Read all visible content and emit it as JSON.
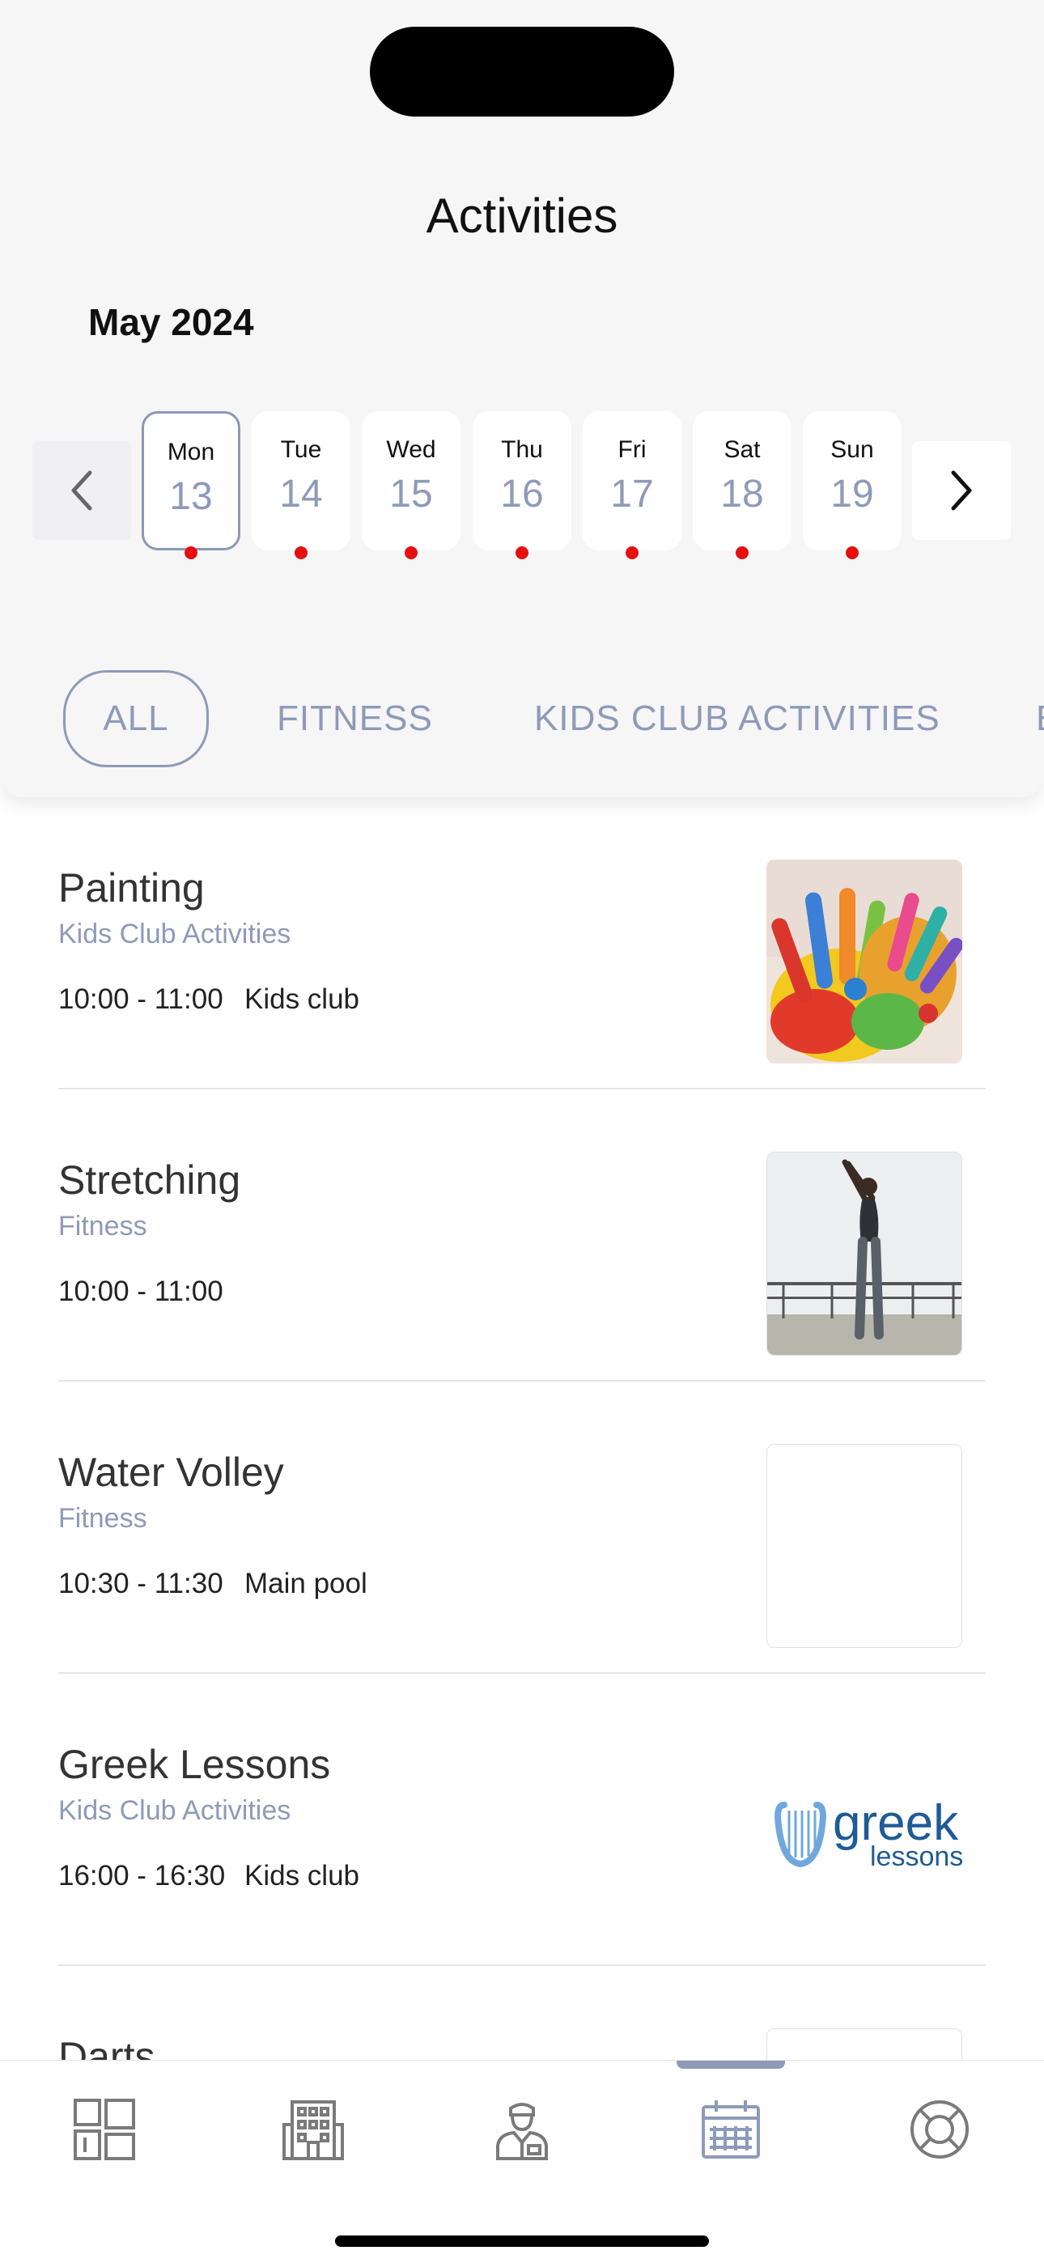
{
  "header": {
    "title": "Activities",
    "month": "May 2024"
  },
  "week": {
    "days": [
      {
        "name": "Mon",
        "num": "13",
        "selected": true
      },
      {
        "name": "Tue",
        "num": "14",
        "selected": false
      },
      {
        "name": "Wed",
        "num": "15",
        "selected": false
      },
      {
        "name": "Thu",
        "num": "16",
        "selected": false
      },
      {
        "name": "Fri",
        "num": "17",
        "selected": false
      },
      {
        "name": "Sat",
        "num": "18",
        "selected": false
      },
      {
        "name": "Sun",
        "num": "19",
        "selected": false
      }
    ],
    "dot_color": "#e60f0f",
    "prev_icon": "chevron-left-icon",
    "next_icon": "chevron-right-icon"
  },
  "filters": {
    "items": [
      "ALL",
      "FITNESS",
      "KIDS CLUB ACTIVITIES",
      "E"
    ],
    "active": "ALL"
  },
  "activities": [
    {
      "title": "Painting",
      "category": "Kids Club Activities",
      "time": "10:00 - 11:00",
      "location": "Kids club",
      "image": "painted-hands-image"
    },
    {
      "title": "Stretching",
      "category": "Fitness",
      "time": "10:00 - 11:00",
      "location": "",
      "image": "stretching-woman-image"
    },
    {
      "title": "Water Volley",
      "category": "Fitness",
      "time": "10:30 - 11:30",
      "location": "Main pool",
      "image": "blank-image"
    },
    {
      "title": "Greek Lessons",
      "category": "Kids Club Activities",
      "time": "16:00 - 16:30",
      "location": "Kids club",
      "image": "greek-lessons-logo",
      "logo_text": "greek",
      "logo_sub": "lessons"
    },
    {
      "title": "Darts",
      "category": "",
      "time": "",
      "location": "",
      "image": "blank-image"
    }
  ],
  "tabbar": {
    "tabs": [
      {
        "icon": "dashboard-icon",
        "active": false
      },
      {
        "icon": "hotel-building-icon",
        "active": false
      },
      {
        "icon": "concierge-icon",
        "active": false
      },
      {
        "icon": "calendar-icon",
        "active": true
      },
      {
        "icon": "lifebuoy-icon",
        "active": false
      }
    ]
  },
  "colors": {
    "accent": "#8e9ab8",
    "text": "#333333",
    "event_dot": "#e60f0f"
  }
}
